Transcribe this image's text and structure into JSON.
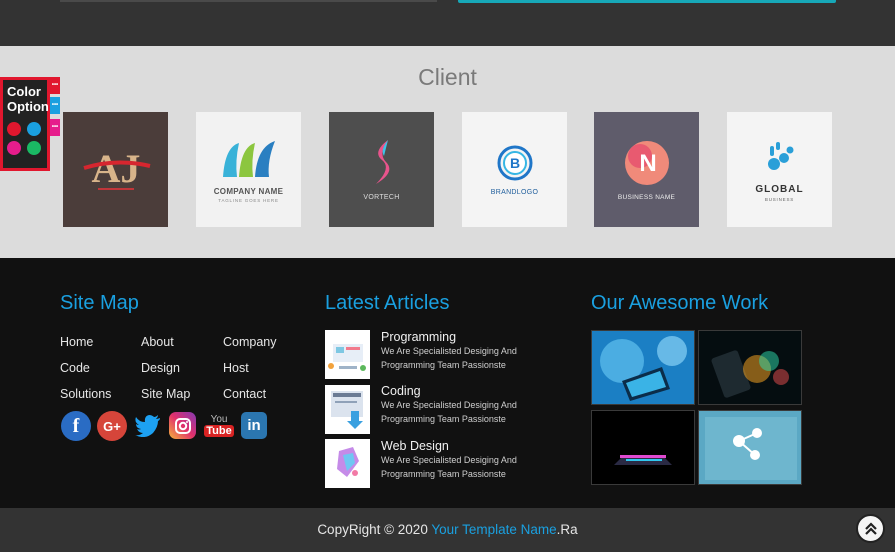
{
  "client": {
    "title": "Client",
    "logos": [
      {
        "name": "AJ",
        "tag": "",
        "bg": "#4b3d3a"
      },
      {
        "name": "COMPANY NAME",
        "tag": "TAGLINE GOES HERE",
        "bg": "#f2f2f2"
      },
      {
        "name": "VORTECH",
        "tag": "",
        "bg": "#4e4e4e"
      },
      {
        "name": "BRANDLOGO",
        "tag": "",
        "bg": "#f4f4f4"
      },
      {
        "name": "BUSINESS NAME",
        "tag": "",
        "bg": "#5f5c6b"
      },
      {
        "name": "GLOBAL",
        "tag": "BUSINESS",
        "bg": "#f4f4f4"
      }
    ]
  },
  "color_option": {
    "title_line1": "Color",
    "title_line2": "Option",
    "swatches": [
      "#e1172e",
      "#1aa0e0",
      "#e61d8c",
      "#1ab964"
    ],
    "tabs": [
      "#e1172e",
      "#1aa0e0",
      "#e61d8c"
    ]
  },
  "sitemap": {
    "title": "Site Map",
    "links": [
      [
        "Home",
        "About",
        "Company"
      ],
      [
        "Code",
        "Design",
        "Host"
      ],
      [
        "Solutions",
        "Site Map",
        "Contact"
      ]
    ],
    "social": [
      "facebook-icon",
      "google-plus-icon",
      "twitter-icon",
      "instagram-icon",
      "youtube-icon",
      "linkedin-icon"
    ]
  },
  "articles": {
    "title": "Latest Articles",
    "items": [
      {
        "title": "Programming",
        "desc1": "We Are Specialisted Desiging And",
        "desc2": "Programming Team Passionste"
      },
      {
        "title": "Coding",
        "desc1": "We Are Specialisted Desiging And",
        "desc2": "Programming Team Passionste"
      },
      {
        "title": "Web Design",
        "desc1": "We Are Specialisted Desiging And",
        "desc2": "Programming Team Passionste"
      }
    ]
  },
  "work": {
    "title": "Our Awesome Work"
  },
  "footer": {
    "copy_prefix": "CopyRight © 2020 ",
    "copy_brand": "Your Template Name",
    "copy_suffix": ".Ra"
  },
  "colors": {
    "accent": "#1aa0e0",
    "red": "#e1172e",
    "teal": "#17a8b8"
  }
}
